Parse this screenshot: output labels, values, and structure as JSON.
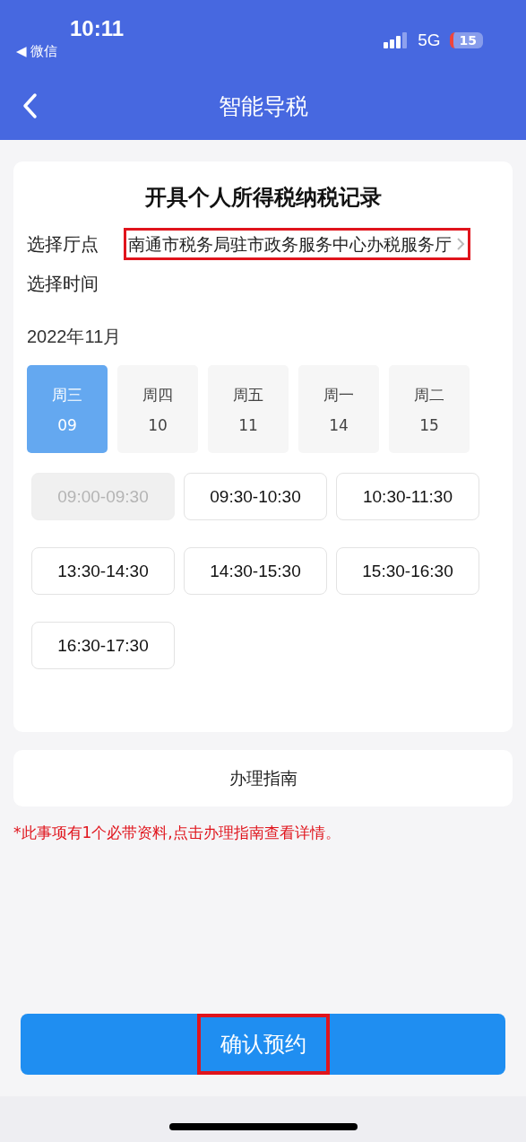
{
  "status_bar": {
    "back_app": "◀ 微信",
    "time": "10:11",
    "network": "5G",
    "battery": "15"
  },
  "nav": {
    "title": "智能导税"
  },
  "card": {
    "title": "开具个人所得税纳税记录",
    "fields": [
      {
        "label": "选择厅点",
        "value": "南通市税务局驻市政务服务中心办税服务厅",
        "highlighted": true
      },
      {
        "label": "选择时间"
      }
    ],
    "month": "2022年11月",
    "days": [
      {
        "weekday": "周三",
        "date": "09",
        "selected": true
      },
      {
        "weekday": "周四",
        "date": "10",
        "selected": false
      },
      {
        "weekday": "周五",
        "date": "11",
        "selected": false
      },
      {
        "weekday": "周一",
        "date": "14",
        "selected": false
      },
      {
        "weekday": "周二",
        "date": "15",
        "selected": false
      }
    ],
    "slots": [
      {
        "label": "09:00-09:30",
        "disabled": true
      },
      {
        "label": "09:30-10:30",
        "disabled": false
      },
      {
        "label": "10:30-11:30",
        "disabled": false
      },
      {
        "label": "13:30-14:30",
        "disabled": false
      },
      {
        "label": "14:30-15:30",
        "disabled": false
      },
      {
        "label": "15:30-16:30",
        "disabled": false
      },
      {
        "label": "16:30-17:30",
        "disabled": false
      }
    ]
  },
  "guide": {
    "label": "办理指南"
  },
  "notice": "*此事项有1个必带资料,点击办理指南查看详情。",
  "confirm": {
    "label": "确认预约",
    "highlighted": true
  }
}
